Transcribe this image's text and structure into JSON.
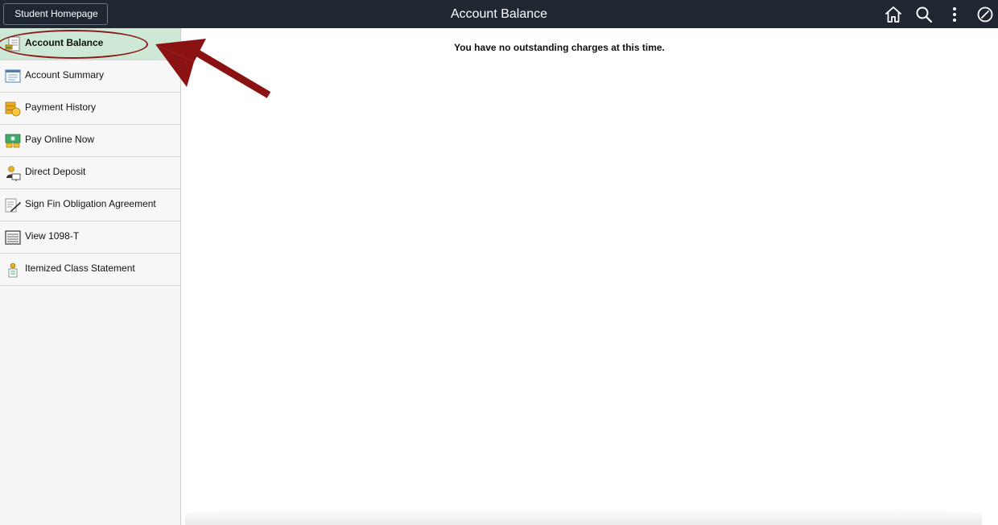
{
  "header": {
    "home_button_label": "Student Homepage",
    "title": "Account Balance",
    "icons": [
      "home-icon",
      "search-icon",
      "more-options-icon",
      "navbar-compass-icon"
    ],
    "background_color": "#1f2733"
  },
  "sidebar": {
    "items": [
      {
        "label": "Account Balance",
        "icon": "account-balance-icon",
        "active": true
      },
      {
        "label": "Account Summary",
        "icon": "account-summary-icon",
        "active": false
      },
      {
        "label": "Payment History",
        "icon": "payment-history-icon",
        "active": false
      },
      {
        "label": "Pay Online Now",
        "icon": "pay-online-icon",
        "active": false
      },
      {
        "label": "Direct Deposit",
        "icon": "direct-deposit-icon",
        "active": false
      },
      {
        "label": "Sign Fin Obligation Agreement",
        "icon": "sign-agreement-icon",
        "active": false
      },
      {
        "label": "View 1098-T",
        "icon": "tax-form-icon",
        "active": false
      },
      {
        "label": "Itemized Class Statement",
        "icon": "class-statement-icon",
        "active": false
      }
    ],
    "active_color": "#cde8d4"
  },
  "main": {
    "message": "You have no outstanding charges at this time."
  },
  "annotation": {
    "color": "#8b1a1a",
    "type": "arrow-and-ellipse"
  }
}
